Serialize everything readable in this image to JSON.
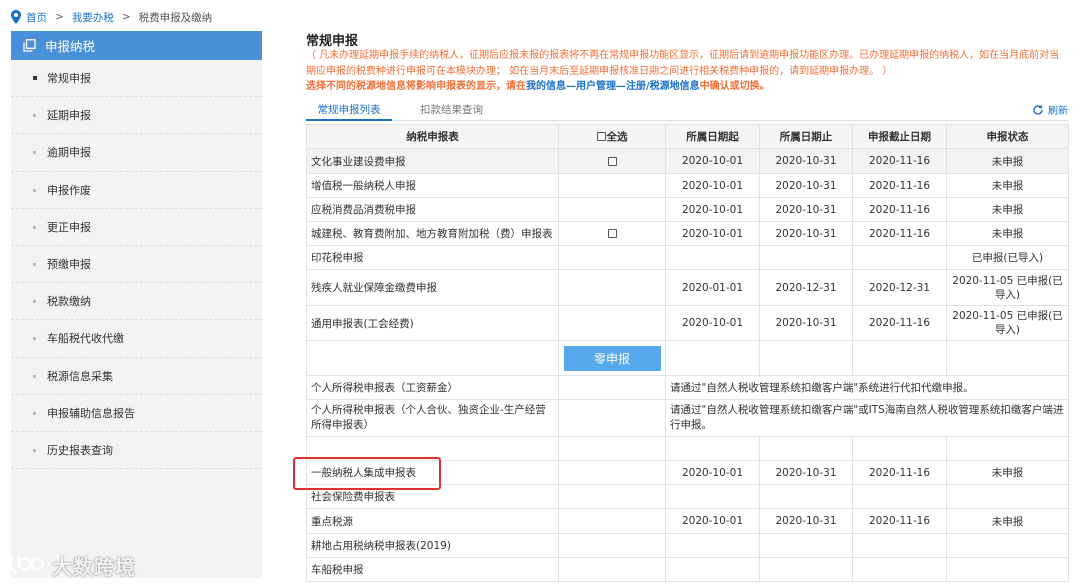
{
  "breadcrumb": {
    "home": "首页",
    "level2": "我要办税",
    "current": "税费申报及缴纳",
    "separator": ">"
  },
  "sidebar": {
    "header": "申报纳税",
    "items": [
      {
        "label": "常规申报",
        "active": true
      },
      {
        "label": "延期申报"
      },
      {
        "label": "逾期申报"
      },
      {
        "label": "申报作废"
      },
      {
        "label": "更正申报"
      },
      {
        "label": "预缴申报"
      },
      {
        "label": "税款缴纳"
      },
      {
        "label": "车船税代收代缴"
      },
      {
        "label": "税源信息采集"
      },
      {
        "label": "申报辅助信息报告"
      },
      {
        "label": "历史报表查询"
      }
    ]
  },
  "main": {
    "title": "常规申报",
    "notice": "（ 凡未办理延期申报手续的纳税人，征期后应报未报的报表将不再在常规申报功能区显示，征期后请到逾期申报功能区办理。已办理延期申报的纳税人，如在当月底前对当期应申报的税费种进行申报可在本模块办理； 如在当月末后至延期申报核准日期之间进行相关税费种申报的，请到延期申报办理。 ）",
    "notice2_prefix": "选择不同的税源地信息将影响申报表的显示，请在",
    "notice2_link": "我的信息—用户管理—注册/税源地信息",
    "notice2_suffix": "中确认或切换。"
  },
  "tabs": {
    "tab1": "常规申报列表",
    "tab2": "扣款结果查询",
    "refresh": "刷新"
  },
  "table": {
    "headers": {
      "form": "纳税申报表",
      "select_all": "全选",
      "start": "所属日期起",
      "end": "所属日期止",
      "deadline": "申报截止日期",
      "status": "申报状态"
    },
    "rows": [
      {
        "name": "文化事业建设费申报",
        "checkbox": true,
        "start": "2020-10-01",
        "end": "2020-10-31",
        "deadline": "2020-11-16",
        "status": "未申报"
      },
      {
        "name": "增值税一般纳税人申报",
        "start": "2020-10-01",
        "end": "2020-10-31",
        "deadline": "2020-11-16",
        "status": "未申报"
      },
      {
        "name": "应税消费品消费税申报",
        "start": "2020-10-01",
        "end": "2020-10-31",
        "deadline": "2020-11-16",
        "status": "未申报"
      },
      {
        "name": "城建税、教育费附加、地方教育附加税（费）申报表",
        "checkbox": true,
        "start": "2020-10-01",
        "end": "2020-10-31",
        "deadline": "2020-11-16",
        "status": "未申报"
      },
      {
        "name": "印花税申报",
        "status": "已申报(已导入)"
      },
      {
        "name": "残疾人就业保障金缴费申报",
        "start": "2020-01-01",
        "end": "2020-12-31",
        "deadline": "2020-12-31",
        "status": "2020-11-05 已申报(已导入)"
      },
      {
        "name": "通用申报表(工会经费)",
        "start": "2020-10-01",
        "end": "2020-10-31",
        "deadline": "2020-11-16",
        "status": "2020-11-05 已申报(已导入)"
      },
      {
        "zero_button": "零申报"
      },
      {
        "name": "个人所得税申报表（工资薪金）",
        "message": "请通过\"自然人税收管理系统扣缴客户端\"系统进行代扣代缴申报。"
      },
      {
        "name": "个人所得税申报表（个人合伙、独资企业-生产经营所得申报表）",
        "message": "请通过\"自然人税收管理系统扣缴客户端\"或ITS海南自然人税收管理系统扣缴客户端进行申报。"
      },
      {
        "blank": true
      },
      {
        "name": "一般纳税人集成申报表",
        "start": "2020-10-01",
        "end": "2020-10-31",
        "deadline": "2020-11-16",
        "status": "未申报"
      },
      {
        "name": "社会保险费申报表"
      },
      {
        "name": "重点税源",
        "start": "2020-10-01",
        "end": "2020-10-31",
        "deadline": "2020-11-16",
        "status": "未申报"
      },
      {
        "name": "耕地占用税纳税申报表(2019)"
      },
      {
        "name": "车船税申报"
      }
    ]
  },
  "watermark": "大数跨境"
}
